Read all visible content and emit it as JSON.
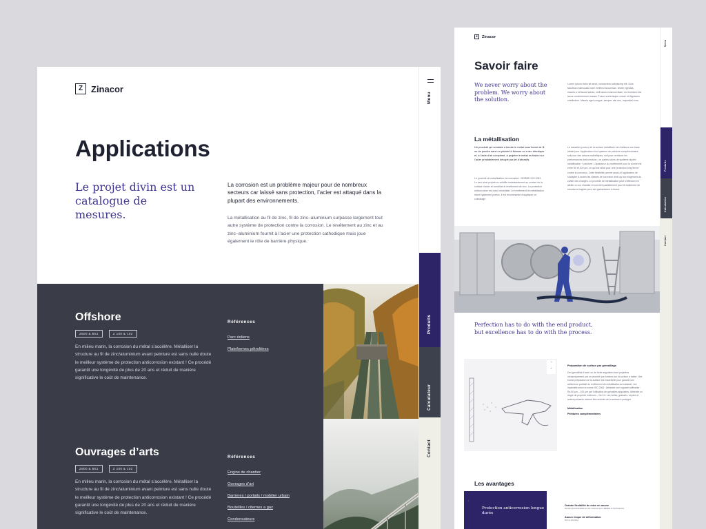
{
  "brand": {
    "name": "Zinacor",
    "mark": "Z"
  },
  "pageA": {
    "title": "Applications",
    "intro": "Le projet divin est un catalogue de mesures.",
    "lead": "La corrosion est un problème majeur pour de nombreux secteurs car laissé sans protection, l’acier est attaqué dans la plupart des environnements.",
    "body": "La métallisation au fil de zinc, fil de zinc–aluminium surpasse largement tout autre système de protection contre la corrosion. Le revêtement au zinc et au zinc–aluminium fournit à l’acier une protection cathodique mais joue également le rôle de barrière physique.",
    "sections": [
      {
        "title": "Offshore",
        "tags": [
          "Z800 & B51",
          "Z 100 & 102"
        ],
        "text": "En milieu marin, la corrosion du métal s’accélère. Métalliser la structure au fil de zinc/aluminium avant peinture est sans nulle doute le meilleur système de protection anticorrosion existant ! Ce procédé garantit une longévité de plus de 20 ans et réduit de manière significative le coût de maintenance.",
        "refs_title": "Références",
        "refs": [
          "Parc éoliens",
          "Plateformes pétrolières"
        ]
      },
      {
        "title": "Ouvrages d’arts",
        "tags": [
          "Z800 & B51",
          "Z 100 & 102"
        ],
        "text": "En milieu marin, la corrosion du métal s’accélère. Métalliser la structure au fil de zinc/aluminium avant peinture est sans nulle doute le meilleur système de protection anticorrosion existant ! Ce procédé garantit une longévité de plus de 20 ans et réduit de manière significative le coût de maintenance.",
        "refs_title": "Références",
        "refs": [
          "Engins de chantier",
          "Ouvrages d’art",
          "Barrieres / portails / mobilier urbain",
          "Bouteilles / citernes a gaz",
          "Condensateurs"
        ]
      }
    ],
    "nav": {
      "menu": "Menu",
      "produits": "Produits",
      "calculateur": "Calculateur",
      "contact": "Contact"
    }
  },
  "pageB": {
    "title": "Savoir faire",
    "intro": "We never worry about the problem. We worry about the solution.",
    "text": "Lorem ipsum dolor sit amet, consectetur adipiscing elit. Duis faucibus malesuada nam eleifend accumsan. Morbi egestas, mauris a vehicula lacinia, velit lacus euismod diam, eu tincidunt nisi lacus condimentum massa. Fusce scelerisque ornare et dignissim vestibulum. Mauris eget congue, semper nisi nec, imperdiet eros.",
    "section": "La métallisation",
    "metal_lead": "Un procédé qui consiste à fondre le métal sous forme de fil ou de poudre dans un pistolet à flamme ou à arc électrique et, à l’aide d’air comprimé, à projeter le métal en fusion sur l’acier préalablement décapé par jet d’abrasifs.",
    "metal_text": "Le procédé de métallisation est normalisé : NORME ISO 2063. Le zinc ainsi projeté se solidifie instantanément au contact de la surface d’acier et constitue le revêtement de zinc. La protection anticorrosion est donc immédiate. Le revêtement de métallisation étant également poreux, il est recommandé d’appliquer un colmatage.",
    "metal_text2": "Le caractère poreux de la surface métallisée est d’ailleurs une base idéale pour l’application d’un système de peinture complémentaire, soit pour des raisons esthétiques, soit pour renforcer les performances anticorrosion ; on parlera alors de système duplex métallisation + peinture. L’épaisseur du revêtement pour la norme est entre 50 et 200 µm, ce qui est idéal pour une protection long terme contre la corrosion. Cette flexibilité permet aussi à l’applicateur de s’adapter à toutes les classes de corrosion ainsi qu’aux exigences du cahier des charges. Le procédé de métallisation peut s’effectuer en atelier ou sur chantier et convient parfaitement pour le traitement de structures fragiles pour des galvanisées à chaud.",
    "quote": "Perfection has to do with the end product, but excellence has to do with the process.",
    "steps_title": "Préparation de surface par grenaillage",
    "steps_text": "Des grenailles d’acier ou de fonte angulaires sont projetées mécaniquement par un procédé par turbines sur la surface à traiter. Une bonne préparation de la surface est essentielle pour garantir une adhérence parfaite du revêtement de métallisation au substrat. Les impératifs selon la norme ISO 2063 : Atteindre une rugosité suffisante : Ra 50 µm – 100 µm par l’utilisation de grenailles angulaires. Atteindre un degré de propreté minimum – Sa 2,5. Les huiles, graisses, oxydes et autres polluants doivent être enlevés de la surface à protéger.",
    "steps_list": [
      "Métallisation",
      "Peintures complémentaires"
    ],
    "adv_title": "Les avantages",
    "adv_card": "Protection anticorrosion longue durée",
    "adv_items": [
      {
        "h": "Grande flexibilité de mise en œuvre",
        "d": "Service personnalisé et sur-mesure qui s’adapte à vos besoins."
      },
      {
        "h": "Aucun risque de déformation",
        "d": "Sur le chantier"
      }
    ],
    "nav": {
      "menu": "Menu",
      "produits": "Produits",
      "calculateur": "Calculateur",
      "contact": "Contact"
    }
  },
  "colors": {
    "accent": "#2c2466",
    "dark_band": "#3a3c48",
    "serif_accent": "#3d3490"
  }
}
